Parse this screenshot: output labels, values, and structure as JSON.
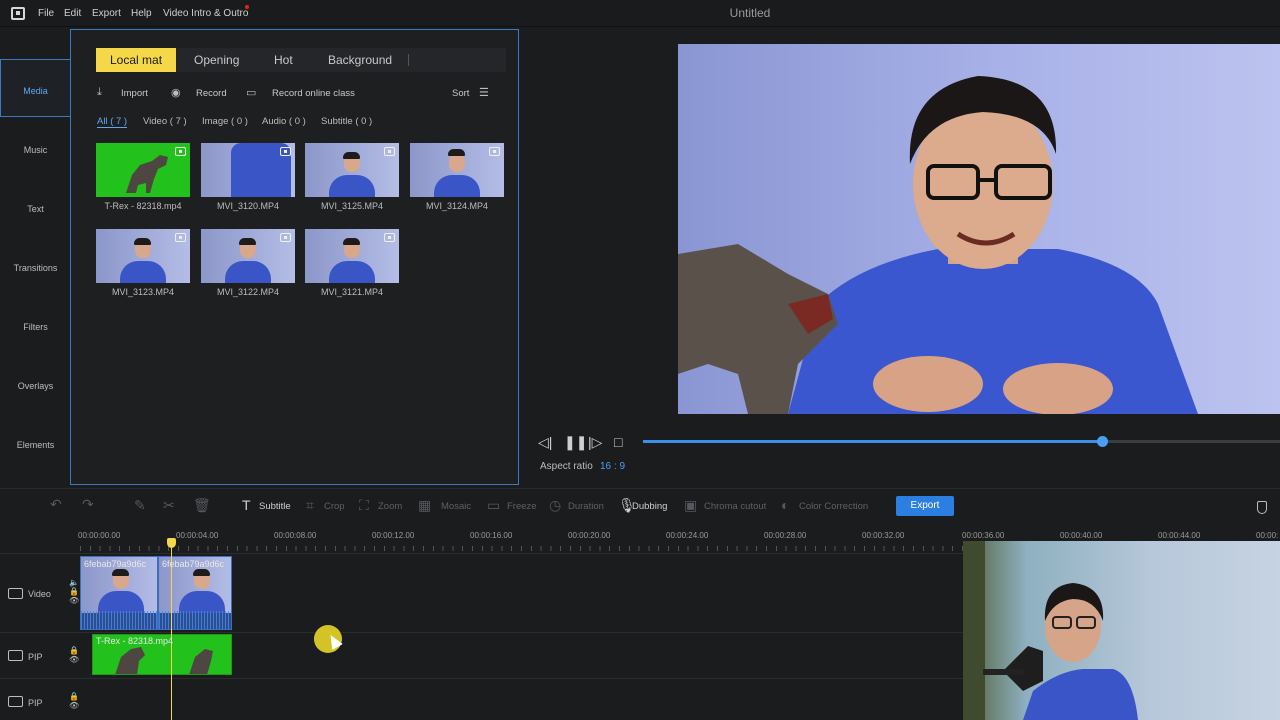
{
  "menubar": {
    "items": [
      "File",
      "Edit",
      "Export",
      "Help",
      "Video Intro & Outro"
    ],
    "window_title": "Untitled"
  },
  "sidebar": {
    "items": [
      {
        "label": "Media",
        "active": true
      },
      {
        "label": "Music"
      },
      {
        "label": "Text"
      },
      {
        "label": "Transitions"
      },
      {
        "label": "Filters"
      },
      {
        "label": "Overlays"
      },
      {
        "label": "Elements"
      }
    ]
  },
  "media": {
    "tabs": [
      "Local mat",
      "Opening",
      "Hot",
      "Background"
    ],
    "tools": {
      "import": "Import",
      "record": "Record",
      "record_online": "Record online class",
      "sort": "Sort"
    },
    "filters": [
      "All ( 7 )",
      "Video ( 7 )",
      "Image ( 0 )",
      "Audio ( 0 )",
      "Subtitle ( 0 )"
    ],
    "files": [
      "T-Rex - 82318.mp4",
      "MVI_3120.MP4",
      "MVI_3125.MP4",
      "MVI_3124.MP4",
      "MVI_3123.MP4",
      "MVI_3122.MP4",
      "MVI_3121.MP4"
    ]
  },
  "preview": {
    "aspect_label": "Aspect ratio",
    "aspect_value": "16 : 9",
    "progress": 0.72
  },
  "toolbar": {
    "items": [
      "Subtitle",
      "Crop",
      "Zoom",
      "Mosaic",
      "Freeze",
      "Duration",
      "Dubbing",
      "Chroma cutout",
      "Color Correction"
    ],
    "export_label": "Export"
  },
  "timeline": {
    "ticks": [
      "00:00:00.00",
      "00:00:04.00",
      "00:00:08.00",
      "00:00:12.00",
      "00:00:16.00",
      "00:00:20.00",
      "00:00:24.00",
      "00:00:28.00",
      "00:00:32.00",
      "00:00:36.00",
      "00:00:40.00",
      "00:00:44.00",
      "00:00:"
    ],
    "tracks": [
      "Video",
      "PIP",
      "PIP"
    ],
    "video_clips": [
      "6febab79a9d6c",
      "6febab79a9d6c"
    ],
    "pip_clip": "T-Rex - 82318.mp4"
  },
  "colors": {
    "accent": "#3b8fe6",
    "tab_active": "#f5d848",
    "export": "#2a7fe0",
    "green_screen": "#22c11c"
  }
}
